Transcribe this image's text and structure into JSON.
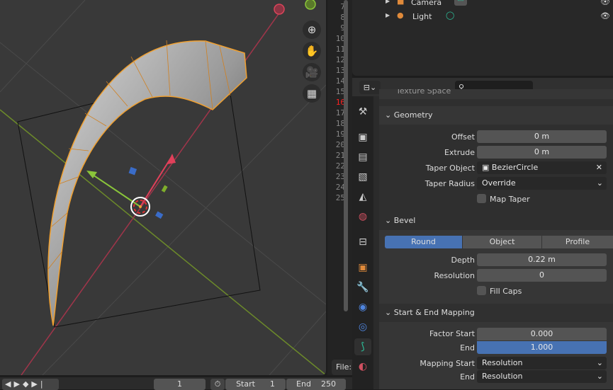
{
  "colors": {
    "accent": "#4772b3",
    "selection": "#f0a030",
    "x_axis": "#c6394a",
    "y_axis": "#7fae2b",
    "line_current": "#ff2020"
  },
  "viewport": {
    "nav_icons": [
      "zoom-icon",
      "hand-pan-icon",
      "camera-view-icon",
      "grid-ortho-icon"
    ]
  },
  "text_editor": {
    "line_numbers": [
      "7",
      "8",
      "9",
      "10",
      "11",
      "12",
      "13",
      "14",
      "15",
      "16",
      "17",
      "18",
      "19",
      "20",
      "21",
      "22",
      "23",
      "24",
      "25"
    ],
    "current_line": "16",
    "file_label": "File:"
  },
  "outliner": {
    "items": [
      {
        "label": "Camera",
        "icon": "camera-icon",
        "data_icon": "camera-data-icon"
      },
      {
        "label": "Light",
        "icon": "light-icon",
        "data_icon": "light-data-icon"
      }
    ]
  },
  "properties": {
    "partial_panel": "Texture Space",
    "tabs": [
      "tool-icon",
      "render-icon",
      "output-icon",
      "view-layer-icon",
      "scene-icon",
      "world-icon",
      "collection-icon",
      "object-icon",
      "modifier-icon",
      "particles-icon",
      "physics-icon",
      "curve-data-icon",
      "material-icon"
    ],
    "geometry": {
      "title": "Geometry",
      "offset_label": "Offset",
      "offset": "0 m",
      "extrude_label": "Extrude",
      "extrude": "0 m",
      "taper_object_label": "Taper Object",
      "taper_object": "BezierCircle",
      "taper_radius_label": "Taper Radius",
      "taper_radius": "Override",
      "map_taper_label": "Map Taper",
      "map_taper": false
    },
    "bevel": {
      "title": "Bevel",
      "modes": [
        "Round",
        "Object",
        "Profile"
      ],
      "active_mode": "Round",
      "depth_label": "Depth",
      "depth": "0.22 m",
      "resolution_label": "Resolution",
      "resolution": "0",
      "fill_caps_label": "Fill Caps",
      "fill_caps": false
    },
    "mapping": {
      "title": "Start & End Mapping",
      "factor_start_label": "Factor Start",
      "factor_start": "0.000",
      "end_label": "End",
      "factor_end": "1.000",
      "mapping_start_label": "Mapping Start",
      "mapping_start": "Resolution",
      "mapping_end_label": "End",
      "mapping_end": "Resolution"
    }
  },
  "timeline": {
    "current_frame": "1",
    "start_label": "Start",
    "start": "1",
    "end_label": "End",
    "end": "250"
  }
}
